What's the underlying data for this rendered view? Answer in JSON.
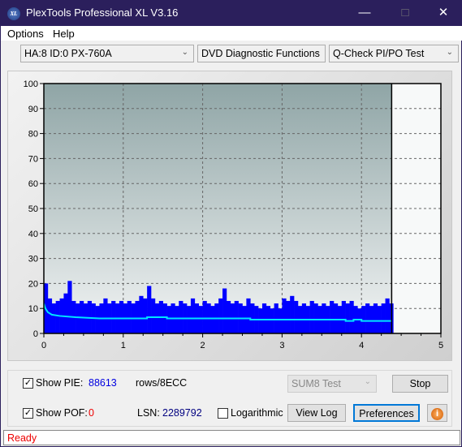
{
  "window": {
    "title": "PlexTools Professional XL V3.16",
    "logo_text": "XL"
  },
  "menu": [
    {
      "label": "Options"
    },
    {
      "label": "Help"
    }
  ],
  "toolbar": {
    "drive": "HA:8 ID:0  PX-760A",
    "function": "DVD Diagnostic Functions",
    "test": "Q-Check PI/PO Test"
  },
  "chart_data": {
    "type": "bar",
    "xlim": [
      0,
      5
    ],
    "ylim": [
      0,
      100
    ],
    "x_ticks": [
      "0",
      "1",
      "2",
      "3",
      "4",
      "5"
    ],
    "y_ticks": [
      "0",
      "10",
      "20",
      "30",
      "40",
      "50",
      "60",
      "70",
      "80",
      "90",
      "100"
    ],
    "grid": true,
    "bar_width": 0.05,
    "x_start": 0,
    "series": [
      {
        "values": [
          20,
          14,
          12,
          13,
          14,
          16,
          21,
          13,
          12,
          13,
          12,
          13,
          12,
          11,
          12,
          14,
          12,
          13,
          12,
          13,
          12,
          13,
          12,
          13,
          15,
          14,
          19,
          14,
          12,
          13,
          12,
          11,
          12,
          11,
          13,
          12,
          11,
          14,
          12,
          11,
          13,
          12,
          11,
          12,
          14,
          18,
          13,
          12,
          13,
          12,
          11,
          14,
          12,
          11,
          10,
          12,
          11,
          10,
          12,
          10,
          14,
          13,
          15,
          13,
          11,
          12,
          11,
          13,
          12,
          11,
          12,
          11,
          13,
          12,
          11,
          13,
          12,
          13,
          11,
          10,
          11,
          12,
          11,
          12,
          11,
          12,
          14,
          12
        ]
      }
    ],
    "average_line": [
      [
        0,
        12
      ],
      [
        0.02,
        10
      ],
      [
        0.05,
        8.5
      ],
      [
        0.1,
        7.5
      ],
      [
        0.2,
        7
      ],
      [
        0.4,
        6.5
      ],
      [
        0.7,
        6
      ],
      [
        1.3,
        6
      ],
      [
        1.3,
        6.5
      ],
      [
        1.55,
        6.5
      ],
      [
        1.55,
        6
      ],
      [
        2.6,
        6
      ],
      [
        2.6,
        5.5
      ],
      [
        3.8,
        5.5
      ],
      [
        3.8,
        5
      ],
      [
        3.9,
        5
      ],
      [
        3.9,
        5.5
      ],
      [
        4.0,
        5.5
      ],
      [
        4.0,
        5
      ],
      [
        4.38,
        5
      ]
    ],
    "end_marker_x": 4.38,
    "colors": {
      "bars": "#0000ff",
      "average": "#00e5ff",
      "plot_top": "#8fa5a6",
      "plot_bottom": "#f2f4f4"
    }
  },
  "controls": {
    "show_pie_label": "Show PIE:",
    "pie_value": "88613",
    "pie_unit": "rows/8ECC",
    "show_pof_label": "Show POF:",
    "pof_value": "0",
    "lsn_label": "LSN:",
    "lsn_value": "2289792",
    "logarithmic_label": "Logarithmic",
    "sum8": "SUM8 Test",
    "stop": "Stop",
    "view_log": "View Log",
    "preferences": "Preferences"
  },
  "status": "Ready"
}
